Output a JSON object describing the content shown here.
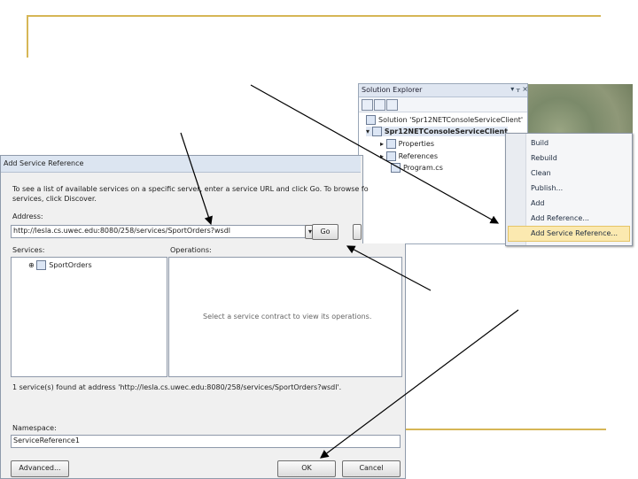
{
  "solution_explorer": {
    "title": "Solution Explorer",
    "pin_label": "▾ ᚁ ×",
    "solution": "Solution 'Spr12NETConsoleServiceClient'",
    "project": "Spr12NETConsoleServiceClient",
    "items": [
      "Properties",
      "References",
      "Program.cs"
    ]
  },
  "context_menu": {
    "items": [
      "Build",
      "Rebuild",
      "Clean",
      "Publish...",
      "Add",
      "Add Reference...",
      "Add Service Reference..."
    ]
  },
  "dialog": {
    "title": "Add Service Reference",
    "instructions": "To see a list of available services on a specific server, enter a service URL and click Go. To browse fo",
    "instructions2": "services, click Discover.",
    "address_label": "Address:",
    "address_value": "http://lesla.cs.uwec.edu:8080/258/services/SportOrders?wsdl",
    "go_label": "Go",
    "services_label": "Services:",
    "service_item": "SportOrders",
    "operations_label": "Operations:",
    "operations_empty": "Select a service contract to view its operations.",
    "status": "1 service(s) found at address 'http://lesla.cs.uwec.edu:8080/258/services/SportOrders?wsdl'.",
    "namespace_label": "Namespace:",
    "namespace_value": "ServiceReference1",
    "advanced_label": "Advanced...",
    "ok_label": "OK",
    "cancel_label": "Cancel"
  },
  "colors": {
    "accent_gold": "#d6b656",
    "highlight": "#fbe9b0"
  }
}
